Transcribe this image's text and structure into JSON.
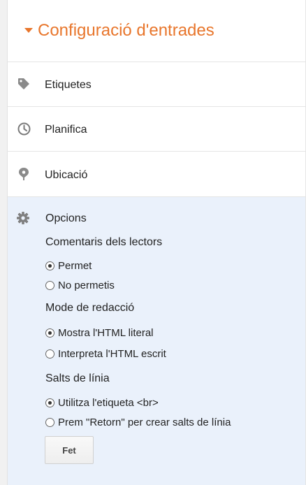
{
  "header": {
    "title": "Configuració d'entrades"
  },
  "rows": [
    {
      "label": "Etiquetes",
      "icon": "tag-icon"
    },
    {
      "label": "Planifica",
      "icon": "clock-icon"
    },
    {
      "label": "Ubicació",
      "icon": "location-pin-icon"
    }
  ],
  "options": {
    "title": "Opcions",
    "icon": "gear-icon",
    "sections": [
      {
        "title": "Comentaris dels lectors",
        "choices": [
          {
            "label": "Permet",
            "checked": true
          },
          {
            "label": "No permetis",
            "checked": false
          }
        ]
      },
      {
        "title": "Mode de redacció",
        "choices": [
          {
            "label": "Mostra l'HTML literal",
            "checked": true
          },
          {
            "label": "Interpreta l'HTML escrit",
            "checked": false
          }
        ]
      },
      {
        "title": "Salts de línia",
        "choices": [
          {
            "label": "Utilitza l'etiqueta <br>",
            "checked": true
          },
          {
            "label": "Prem \"Retorn\" per crear salts de línia",
            "checked": false
          }
        ]
      }
    ],
    "done_label": "Fet"
  },
  "colors": {
    "accent": "#e8762c",
    "options_bg": "#eaf1fb"
  }
}
